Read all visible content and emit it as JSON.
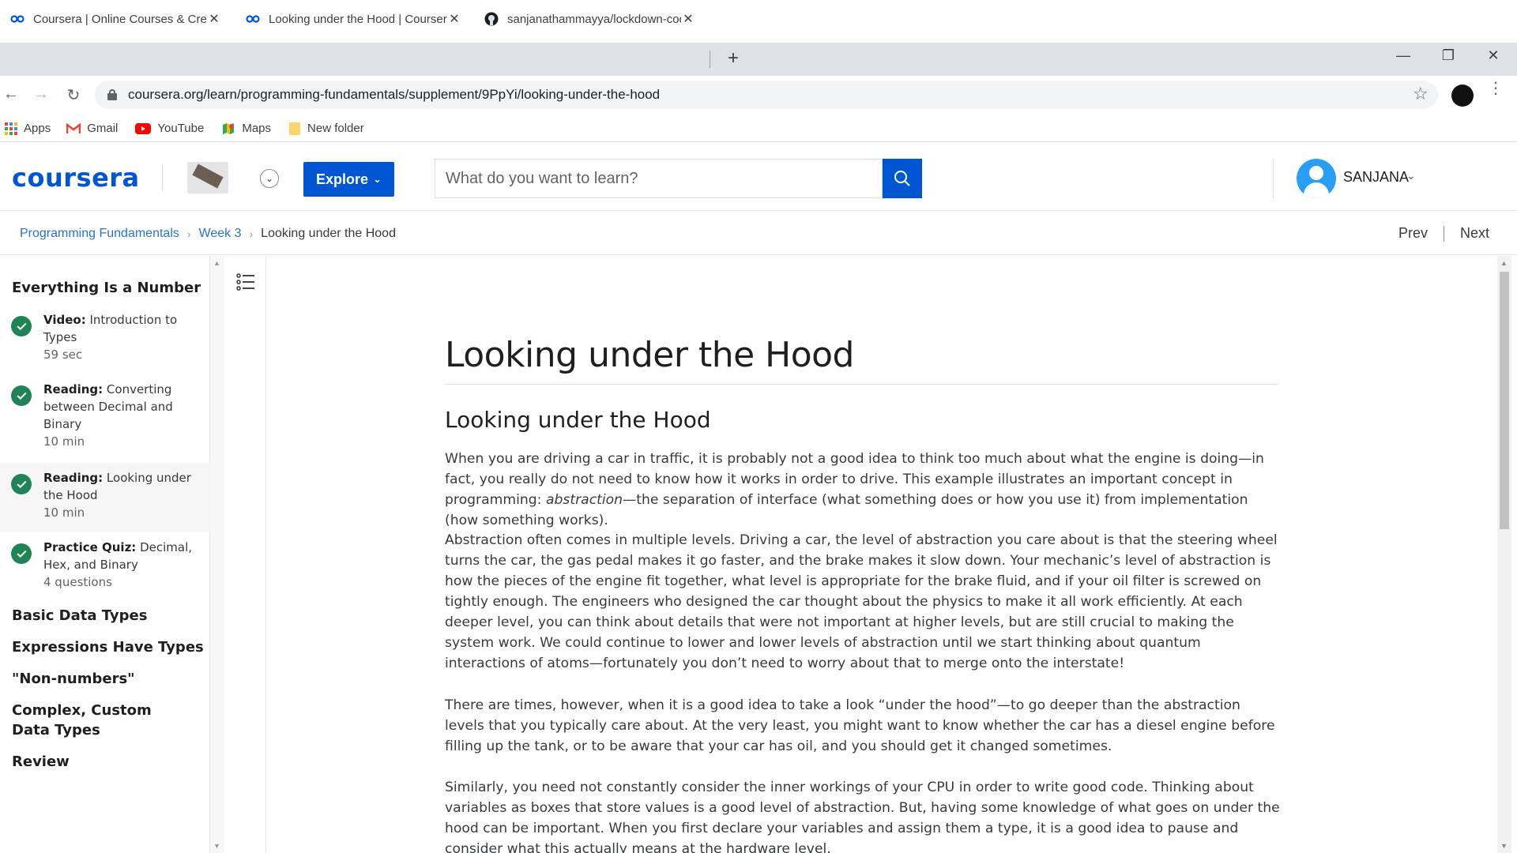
{
  "browser": {
    "tabs": [
      {
        "title": "Coursera | Online Courses & Credentials",
        "icon": "coursera-icon"
      },
      {
        "title": "Looking under the Hood | Coursera",
        "icon": "coursera-icon"
      },
      {
        "title": "sanjanathammayya/lockdown-coding",
        "icon": "github-icon"
      }
    ],
    "new_tab": "+",
    "url": "coursera.org/learn/programming-fundamentals/supplement/9PpYi/looking-under-the-hood",
    "bookmarks": [
      {
        "label": "Apps",
        "icon": "apps-grid-icon"
      },
      {
        "label": "Gmail",
        "icon": "gmail-icon"
      },
      {
        "label": "YouTube",
        "icon": "youtube-icon"
      },
      {
        "label": "Maps",
        "icon": "maps-icon"
      },
      {
        "label": "New folder",
        "icon": "folder-icon"
      }
    ],
    "window_controls": {
      "minimize": "—",
      "restore": "❐",
      "close": "✕"
    }
  },
  "header": {
    "logo": "coursera",
    "explore_label": "Explore",
    "search_placeholder": "What do you want to learn?",
    "user_name": "SANJANA",
    "brand_color": "#0056d2"
  },
  "breadcrumb": {
    "items": [
      "Programming Fundamentals",
      "Week 3"
    ],
    "current": "Looking under the Hood",
    "prev": "Prev",
    "next": "Next"
  },
  "sidebar": {
    "section_title": "Everything Is a Number",
    "items": [
      {
        "type": "Video:",
        "title": "Introduction to Types",
        "meta": "59 sec",
        "done": true
      },
      {
        "type": "Reading:",
        "title": "Converting between Decimal and Binary",
        "meta": "10 min",
        "done": true
      },
      {
        "type": "Reading:",
        "title": "Looking under the Hood",
        "meta": "10 min",
        "done": true,
        "active": true
      },
      {
        "type": "Practice Quiz:",
        "title": "Decimal, Hex, and Binary",
        "meta": "4 questions",
        "done": true
      }
    ],
    "modules": [
      "Basic Data Types",
      "Expressions Have Types",
      "\"Non-numbers\"",
      "Complex, Custom Data Types",
      "Review"
    ]
  },
  "content": {
    "title": "Looking under the Hood",
    "subtitle": "Looking under the Hood",
    "p1_before": "When you are driving a car in traffic, it is probably not a good idea to think too much about what the engine is doing—in fact, you really do not need to know how it works in order to drive. This example illustrates an important concept in programming: ",
    "p1_italic": "abstraction",
    "p1_after": "—the separation of interface (what something does or how you use it) from implementation (how something works).",
    "p2": "Abstraction often comes in multiple levels. Driving a car, the level of abstraction you care about is that the steering wheel turns the car, the gas pedal makes it go faster, and the brake makes it slow down. Your mechanic’s level of abstraction is how the pieces of the engine fit together, what level is appropriate for the brake fluid, and if your oil filter is screwed on tightly enough. The engineers who designed the car thought about the physics to make it all work efficiently. At each deeper level, you can think about details that were not important at higher levels, but are still crucial to making the system work. We could continue to lower and lower levels of abstraction until we start thinking about quantum interactions of atoms—fortunately you don’t need to worry about that to merge onto the interstate!",
    "p3": "There are times, however, when it is a good idea to take a look “under the hood”—to go deeper than the abstraction levels that you typically care about. At the very least, you might want to know whether the car has a diesel engine before filling up the tank, or to be aware that your car has oil, and you should get it changed sometimes.",
    "p4": "Similarly, you need not constantly consider the inner workings of your CPU in order to write good code. Thinking about variables as boxes that store values is a good level of abstraction. But, having some knowledge of what goes on under the hood can be important. When you first declare your variables and assign them a type, it is a good idea to pause and consider what this actually means at the hardware level."
  }
}
